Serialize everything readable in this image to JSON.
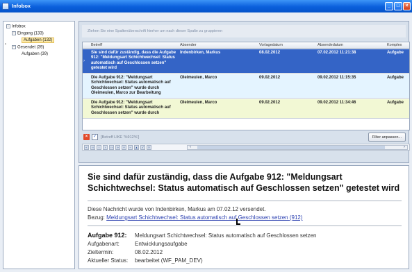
{
  "window": {
    "title": "Infobox"
  },
  "tree": {
    "root": "Infobox",
    "inbox": "Eingang (133)",
    "inbox_tasks": "Aufgaben (132)",
    "sent": "Gesendet (39)",
    "sent_tasks": "Aufgaben (39)"
  },
  "grid": {
    "group_hint": "Ziehen Sie eine Spaltenüberschrift hierher um nach dieser Spalte zu gruppieren",
    "columns": [
      "Betreff",
      "Absender",
      "Vorlagedatum",
      "Absendedatum",
      "Komplex"
    ],
    "rows": [
      {
        "betreff": "Sie sind dafür zuständig, dass die Aufgabe 912: \"Meldungsart Schichtwechsel: Status automatisch auf Geschlossen setzen\" getestet wird",
        "absender": "Indenbirken, Markus",
        "vorlage": "08.02.2012",
        "absende": "07.02.2012 11:21:38",
        "komplex": "Aufgabe"
      },
      {
        "betreff": "Die Aufgabe 912: \"Meldungsart Schichtwechsel: Status automatisch auf Geschlossen setzen\" wurde durch Oleimeulen, Marco zur Bearbeitung",
        "absender": "Oleimeulen, Marco",
        "vorlage": "09.02.2012",
        "absende": "09.02.2012 11:15:35",
        "komplex": "Aufgabe"
      },
      {
        "betreff": "Die Aufgabe 912: \"Meldungsart Schichtwechsel: Status automatisch auf Geschlossen setzen\" wurde durch",
        "absender": "Oleimeulen, Marco",
        "vorlage": "09.02.2012",
        "absende": "09.02.2012 11:34:46",
        "komplex": "Aufgabe"
      }
    ],
    "filter_text": "[Betreff LIKE '%912%']",
    "filter_button": "Filter anpassen..."
  },
  "preview": {
    "subject": "Sie sind dafür zuständig, dass die Aufgabe 912: \"Meldungsart Schichtwechsel: Status automatisch auf Geschlossen setzen\" getestet wird",
    "sent_line": "Diese Nachricht wurde von Indenbirken, Markus am 07.02.12 versendet.",
    "ref_label": "Bezug:",
    "ref_link": "Meldungsart Schichtwechsel: Status automatisch auf Geschlossen setzen (912)",
    "task_label": "Aufgabe 912:",
    "task_value": "Meldungsart Schichtwechsel: Status automatisch auf Geschlossen setzen",
    "type_label": "Aufgabenart:",
    "type_value": "Entwicklungsaufgabe",
    "due_label": "Zieltermin:",
    "due_value": "08.02.2012",
    "status_label": "Aktueller Status:",
    "status_value": "bearbeitet (WF_PAM_DEV)"
  },
  "colors": {
    "titlebar": "#0a5fdc",
    "selected_row": "#3464c6",
    "row_blue": "#e4f4ff",
    "row_green": "#f2f8d4",
    "link": "#2a3fb0"
  },
  "icons": [
    "window-icon",
    "minimize-icon",
    "maximize-icon",
    "close-icon",
    "clear-filter-icon",
    "filter-checkbox-icon",
    "mouse-cursor-icon"
  ]
}
